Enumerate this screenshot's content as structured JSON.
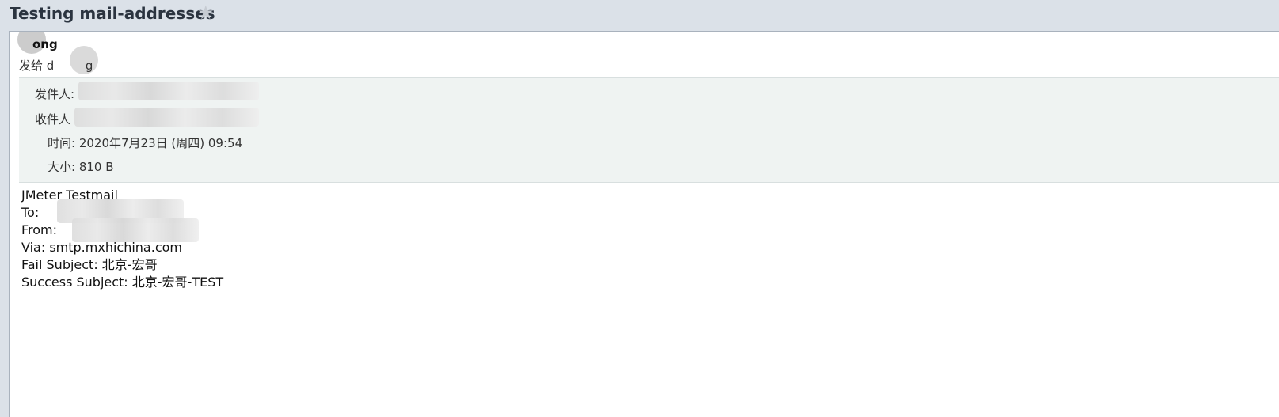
{
  "email": {
    "subject": "Testing mail-addresses",
    "star_icon": "star-icon",
    "sender": {
      "name_visible": "ong",
      "to_prefix": "发给",
      "to_fragment": "d",
      "to_suffix": "g"
    },
    "header": {
      "from_label": "发件人:",
      "to_label": "收件人",
      "time_label": "时间:",
      "time_value": "2020年7月23日 (周四) 09:54",
      "size_label": "大小:",
      "size_value": "810 B"
    },
    "body": [
      "JMeter Testmail",
      "To:",
      "From:",
      "Via:  smtp.mxhichina.com",
      "Fail Subject:  北京-宏哥",
      "Success Subject:  北京-宏哥-TEST"
    ]
  }
}
